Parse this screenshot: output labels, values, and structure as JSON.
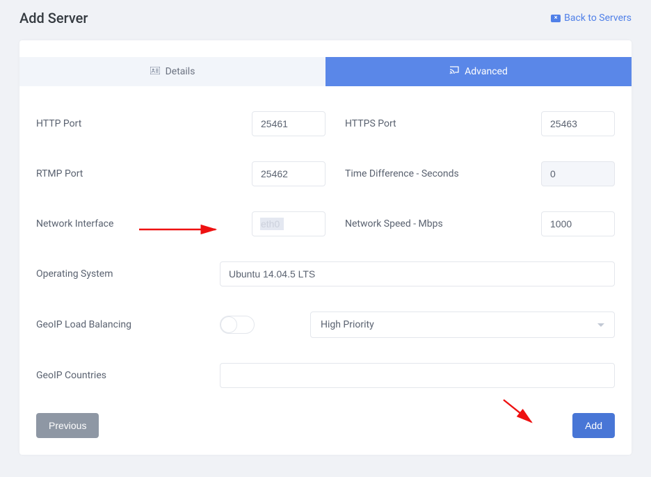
{
  "header": {
    "title": "Add Server",
    "back_label": "Back to Servers"
  },
  "tabs": {
    "details": "Details",
    "advanced": "Advanced"
  },
  "form": {
    "http_port": {
      "label": "HTTP Port",
      "value": "25461"
    },
    "https_port": {
      "label": "HTTPS Port",
      "value": "25463"
    },
    "rtmp_port": {
      "label": "RTMP Port",
      "value": "25462"
    },
    "time_diff": {
      "label": "Time Difference - Seconds",
      "value": "0"
    },
    "network_iface": {
      "label": "Network Interface",
      "value": "eth0"
    },
    "network_speed": {
      "label": "Network Speed - Mbps",
      "value": "1000"
    },
    "os": {
      "label": "Operating System",
      "value": "Ubuntu 14.04.5 LTS"
    },
    "geoip_lb": {
      "label": "GeoIP Load Balancing",
      "priority": "High Priority"
    },
    "geoip_countries": {
      "label": "GeoIP Countries",
      "value": ""
    }
  },
  "buttons": {
    "previous": "Previous",
    "add": "Add"
  }
}
